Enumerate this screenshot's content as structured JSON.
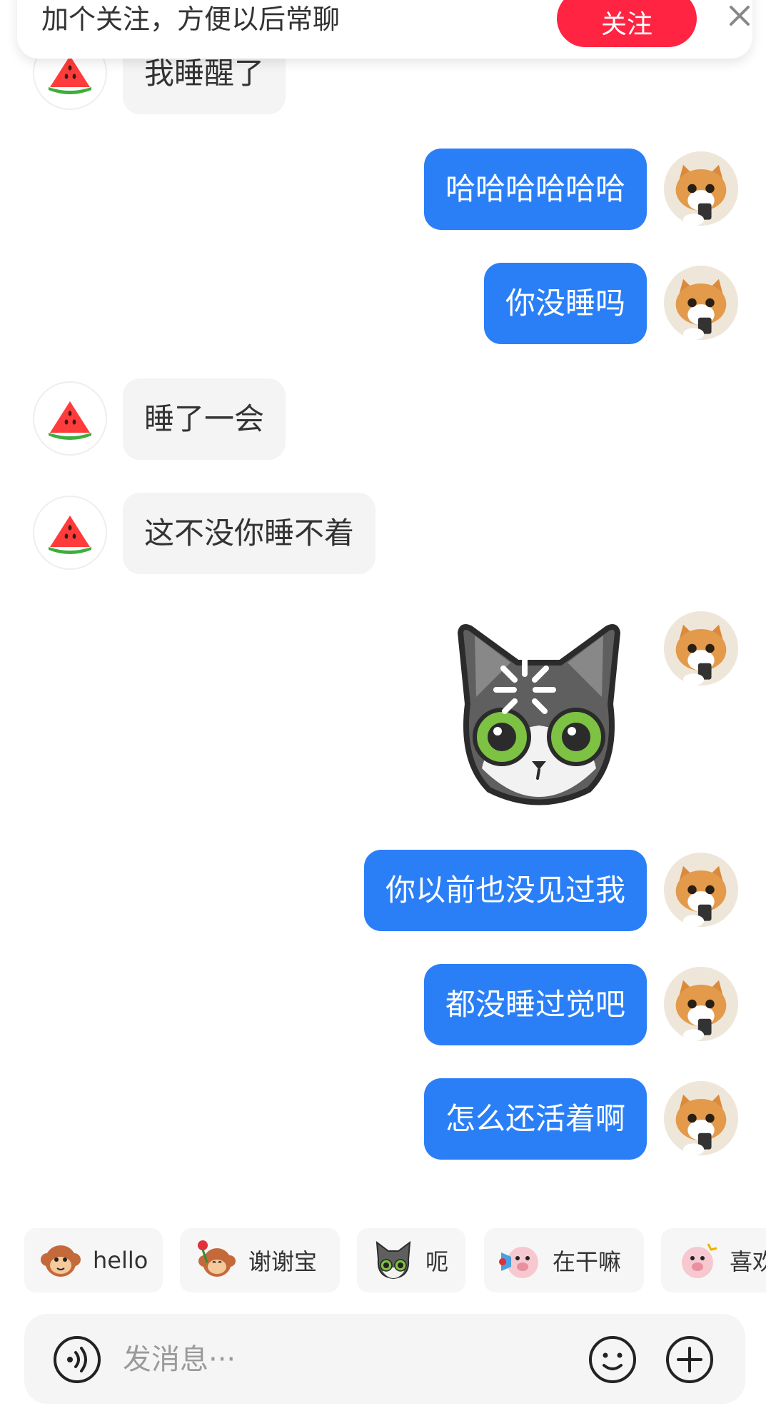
{
  "follow_banner": {
    "text": "加个关注，方便以后常聊",
    "follow_label": "关注"
  },
  "messages": [
    {
      "side": "in",
      "text": "我睡醒了"
    },
    {
      "side": "out",
      "text": "哈哈哈哈哈哈"
    },
    {
      "side": "out",
      "text": "你没睡吗"
    },
    {
      "side": "in",
      "text": "睡了一会"
    },
    {
      "side": "in",
      "text": "这不没你睡不着"
    },
    {
      "side": "out",
      "sticker": "shocked-cat-sticker"
    },
    {
      "side": "out",
      "text": "你以前也没见过我"
    },
    {
      "side": "out",
      "text": "都没睡过觉吧"
    },
    {
      "side": "out",
      "text": "怎么还活着啊"
    }
  ],
  "quick_emojis": [
    {
      "icon": "monkey-emoji",
      "label": "hello"
    },
    {
      "icon": "monkey-rose-emoji",
      "label": "谢谢宝"
    },
    {
      "icon": "cat-emoji",
      "label": "呃"
    },
    {
      "icon": "pig-loudspeaker-emoji",
      "label": "在干嘛"
    },
    {
      "icon": "pig-cheer-emoji",
      "label": "喜欢"
    }
  ],
  "input": {
    "placeholder": "发消息···"
  },
  "colors": {
    "accent_red": "#ff2442",
    "bubble_blue": "#2a7ff7",
    "bubble_gray": "#f4f4f4"
  }
}
